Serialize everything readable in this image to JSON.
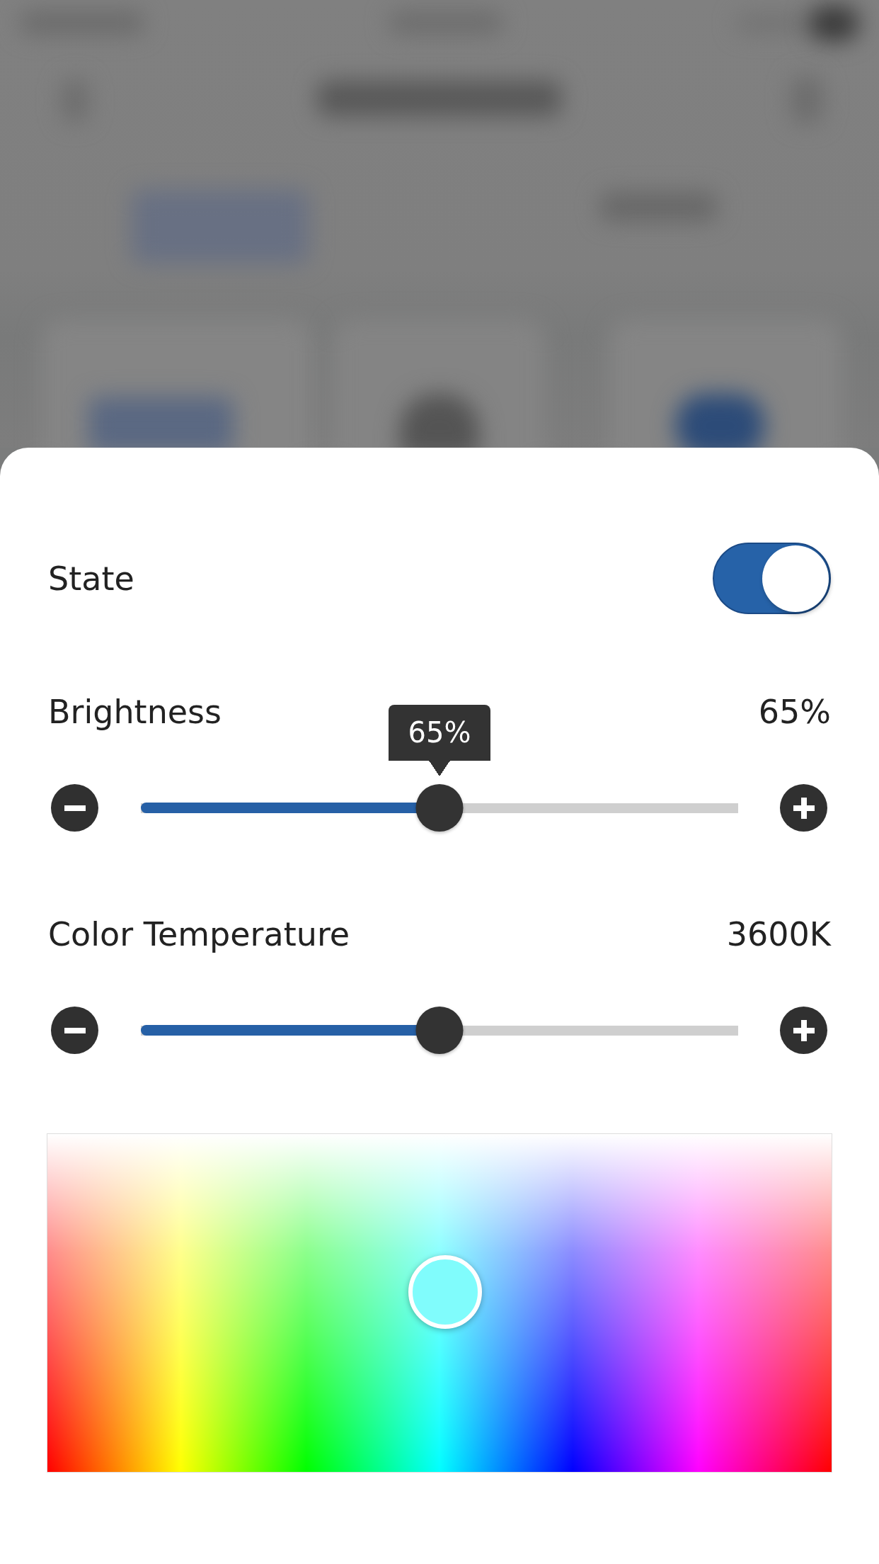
{
  "sheet": {
    "state_toggle": {
      "label": "State",
      "on": true
    },
    "sliders": [
      {
        "label": "Brightness",
        "reading": "65%",
        "level": 0.5,
        "tooltip": "65%"
      },
      {
        "label": "Color Temperature",
        "reading": "3600K",
        "level": 0.5
      }
    ],
    "color_picker": {
      "kind": "spectrum"
    }
  }
}
